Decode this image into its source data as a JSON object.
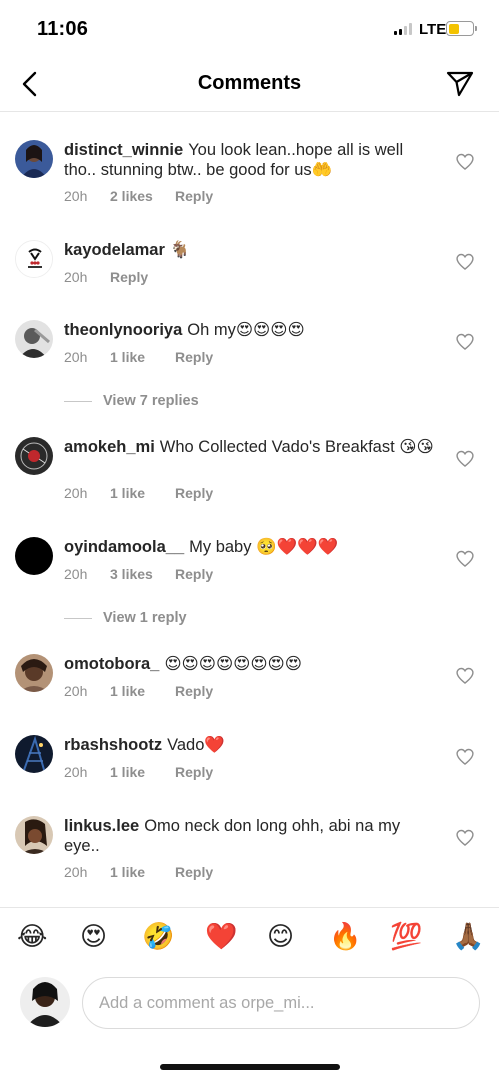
{
  "status_bar": {
    "time": "11:06",
    "network": "LTE",
    "battery_level": 0.45,
    "battery_color": "#f4c300"
  },
  "nav": {
    "title": "Comments",
    "back_icon": "chevron-left-icon",
    "share_icon": "paper-plane-icon"
  },
  "comments": [
    {
      "username": "distinct_winnie",
      "text": "You look lean..hope all is well tho.. stunning btw.. be good for us",
      "emoji": "🤲",
      "time": "20h",
      "likes": "2 likes",
      "reply_label": "Reply"
    },
    {
      "username": "kayodelamar",
      "text": "",
      "emoji": "🐐",
      "time": "20h",
      "likes": "",
      "reply_label": "Reply"
    },
    {
      "username": "theonlynooriya",
      "text": "Oh my",
      "emoji": "😍😍😍😍",
      "time": "20h",
      "likes": "1 like",
      "reply_label": "Reply",
      "view_replies": "View 7 replies"
    },
    {
      "username": "amokeh_mi",
      "text": "Who Collected Vado's Breakfast",
      "emoji": "😘😘",
      "time": "20h",
      "likes": "1 like",
      "reply_label": "Reply"
    },
    {
      "username": "oyindamoola__",
      "text": "My baby",
      "emoji": "🥺❤️❤️❤️",
      "time": "20h",
      "likes": "3 likes",
      "reply_label": "Reply",
      "view_replies": "View 1 reply"
    },
    {
      "username": "omotobora_",
      "text": "",
      "emoji": "😍😍😍😍😍😍😍😍",
      "time": "20h",
      "likes": "1 like",
      "reply_label": "Reply"
    },
    {
      "username": "rbashshootz",
      "text": "Vado",
      "emoji": "❤️",
      "time": "20h",
      "likes": "1 like",
      "reply_label": "Reply"
    },
    {
      "username": "linkus.lee",
      "text": "Omo neck don long ohh, abi na my eye..",
      "emoji": "",
      "time": "20h",
      "likes": "1 like",
      "reply_label": "Reply"
    }
  ],
  "quick_emojis": [
    "😂",
    "😍",
    "🤣",
    "❤️",
    "😊",
    "🔥",
    "💯",
    "🙏🏾"
  ],
  "composer": {
    "placeholder": "Add a comment as orpe_mi..."
  },
  "colors": {
    "text_primary": "#262626",
    "text_secondary": "#8e8e8e",
    "divider": "#e6e6e6"
  }
}
